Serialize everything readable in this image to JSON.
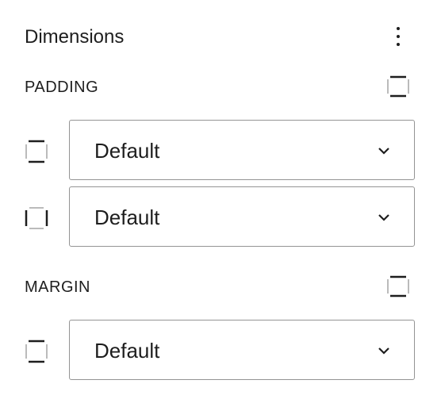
{
  "panel": {
    "title": "Dimensions",
    "menu_icon": "vertical-ellipsis-icon"
  },
  "padding": {
    "label": "PADDING",
    "toggle_icon": "box-sides-icon",
    "rows": [
      {
        "icon": "side-vertical-icon",
        "value": "Default"
      },
      {
        "icon": "side-horizontal-icon",
        "value": "Default"
      }
    ]
  },
  "margin": {
    "label": "MARGIN",
    "toggle_icon": "box-sides-icon",
    "rows": [
      {
        "icon": "side-vertical-icon",
        "value": "Default"
      }
    ]
  },
  "colors": {
    "text": "#1e1e1e",
    "border": "#949494",
    "muted_icon": "#bbbbbb"
  }
}
